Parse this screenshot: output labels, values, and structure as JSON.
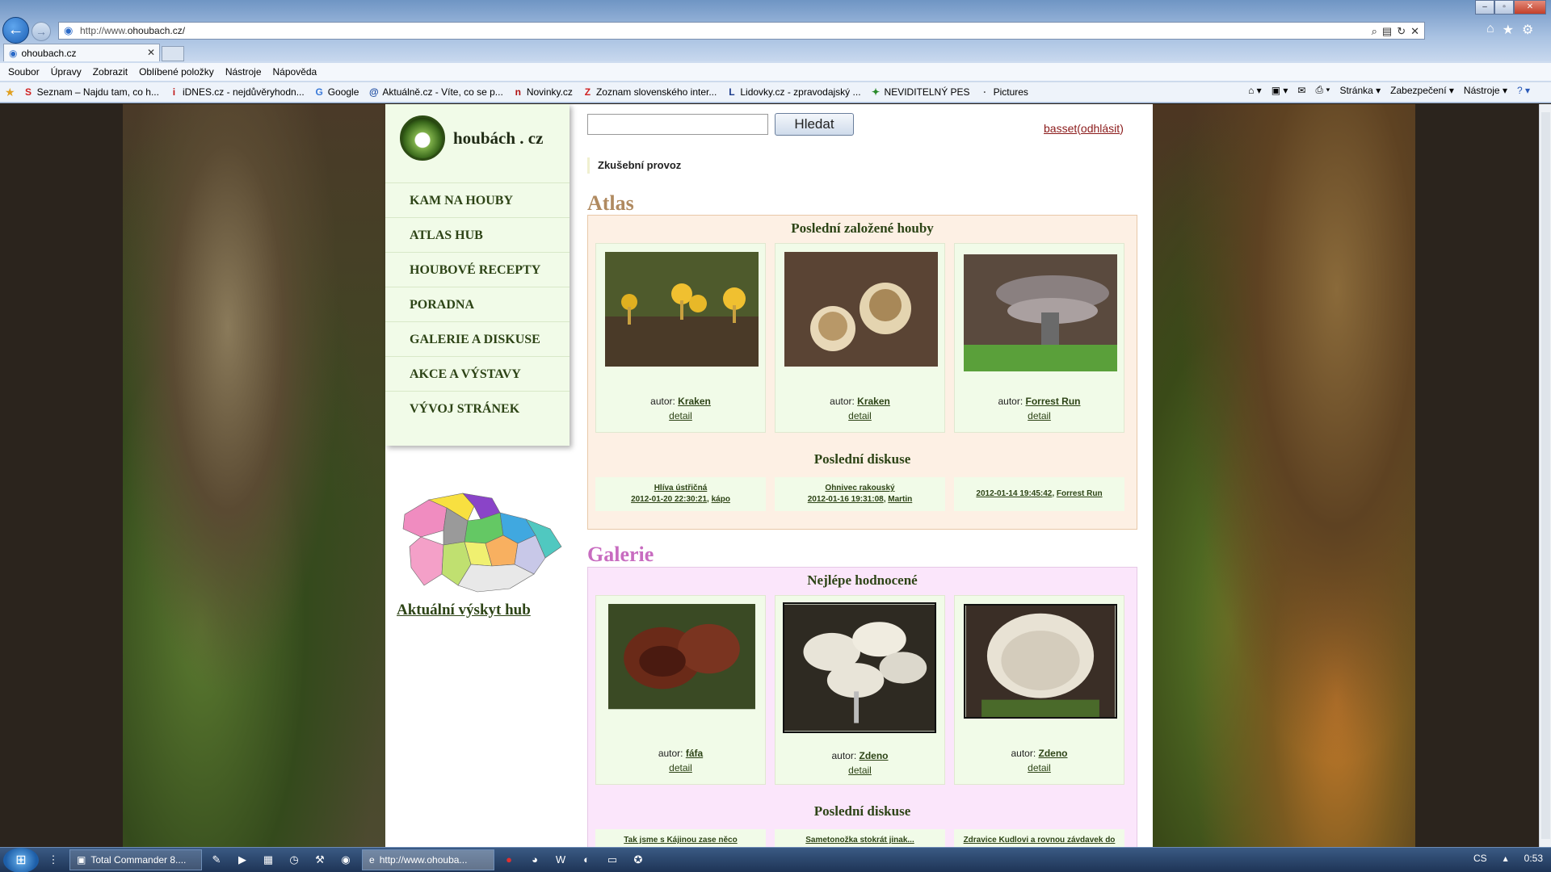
{
  "browser": {
    "url_prefix": "http://www.",
    "url_domain": "ohoubach.cz/",
    "tab_title": "ohoubach.cz",
    "menu": [
      "Soubor",
      "Úpravy",
      "Zobrazit",
      "Oblíbené položky",
      "Nástroje",
      "Nápověda"
    ],
    "favorites": [
      {
        "label": "Seznam – Najdu tam, co h...",
        "icon": "S",
        "color": "#d02020"
      },
      {
        "label": "iDNES.cz - nejdůvěryhodn...",
        "icon": "i",
        "color": "#c01818"
      },
      {
        "label": "Google",
        "icon": "G",
        "color": "#3a7ad8"
      },
      {
        "label": "Aktuálně.cz - Víte, co se p...",
        "icon": "@",
        "color": "#1a4aa0"
      },
      {
        "label": "Novinky.cz",
        "icon": "n",
        "color": "#b01010"
      },
      {
        "label": "Zoznam slovenského inter...",
        "icon": "Z",
        "color": "#d02020"
      },
      {
        "label": "Lidovky.cz - zpravodajský ...",
        "icon": "L",
        "color": "#1a3a8a"
      },
      {
        "label": "NEVIDITELNÝ PES",
        "icon": "✦",
        "color": "#2a8a2a"
      },
      {
        "label": "Pictures",
        "icon": "·",
        "color": "#555"
      }
    ],
    "commands": [
      "Stránka ▾",
      "Zabezpečení ▾",
      "Nástroje ▾"
    ]
  },
  "site": {
    "logo_text": "houbách . cz",
    "nav": [
      "KAM NA HOUBY",
      "ATLAS HUB",
      "HOUBOVÉ RECEPTY",
      "PORADNA",
      "GALERIE A DISKUSE",
      "AKCE A VÝSTAVY",
      "VÝVOJ STRÁNEK"
    ],
    "map_link": "Aktuální výskyt hub",
    "search_button": "Hledat",
    "user_name": "basset",
    "logout": "odhlásit",
    "notice": "Zkušební provoz",
    "atlas": {
      "heading": "Atlas",
      "latest_heading": "Poslední založené houby",
      "author_label": "autor:",
      "detail_label": "detail",
      "cards": [
        {
          "author": "Kraken"
        },
        {
          "author": "Kraken"
        },
        {
          "author": "Forrest Run"
        }
      ],
      "discussion_heading": "Poslední diskuse",
      "discussions": [
        {
          "title": "Hlíva ústřičná",
          "date": "2012-01-20 22:30:21",
          "user": "kápo"
        },
        {
          "title": "Ohnivec rakouský",
          "date": "2012-01-16 19:31:08",
          "user": "Martin"
        },
        {
          "title": "",
          "date": "2012-01-14 19:45:42",
          "user": "Forrest Run"
        }
      ]
    },
    "galerie": {
      "heading": "Galerie",
      "best_heading": "Nejlépe hodnocené",
      "cards": [
        {
          "author": "fáfa"
        },
        {
          "author": "Zdeno"
        },
        {
          "author": "Zdeno"
        }
      ],
      "discussion_heading": "Poslední diskuse",
      "discussions": [
        {
          "title": "Tak jsme s Kájinou zase něco"
        },
        {
          "title": "Sametonožka stokrát jinak..."
        },
        {
          "title": "Zdravice Kudlovi a rovnou závdavek do"
        }
      ]
    }
  },
  "taskbar": {
    "tasks": [
      "Total Commander 8....",
      "http://www.ohouba..."
    ],
    "lang": "CS",
    "time": "0:53"
  }
}
